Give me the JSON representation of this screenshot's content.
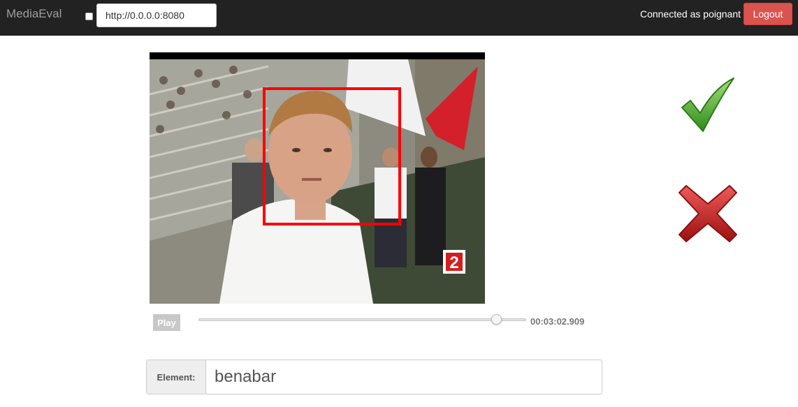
{
  "navbar": {
    "brand": "MediaEval",
    "url_value": "http://0.0.0.0:8080",
    "status": "Connected as poignant",
    "logout_label": "Logout"
  },
  "player": {
    "channel_logo": "2",
    "play_label": "Play",
    "timestamp": "00:03:02.909",
    "progress_fraction": 0.93
  },
  "actions": {
    "accept_icon": "checkmark-icon",
    "reject_icon": "cross-icon",
    "accept_color": "#4cae2a",
    "reject_color": "#c81e1e"
  },
  "annotation": {
    "element_label": "Element:",
    "element_value": "benabar",
    "box_color": "#ff0000"
  }
}
